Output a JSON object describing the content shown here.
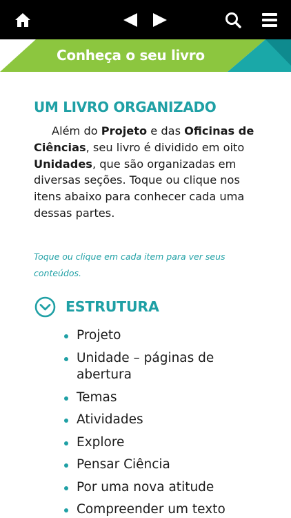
{
  "header": {
    "icons": [
      "home-icon",
      "previous-arrow-icon",
      "next-arrow-icon",
      "search-icon",
      "menu-icon"
    ]
  },
  "banner": {
    "title": "Conheça o seu livro",
    "colors": {
      "green": "#8cc63f",
      "teal": "#1aa8a8",
      "dark_teal": "#0e8a8e"
    }
  },
  "content": {
    "title": "UM LIVRO ORGANIZADO",
    "intro": {
      "part1": "Além do ",
      "bold1": "Projeto",
      "part2": " e das ",
      "bold2": "Oficinas de Ciências",
      "part3": ", seu livro é dividido em oito ",
      "bold3": "Unidades",
      "part4": ", que são organizadas em diversas seções. Toque ou clique nos itens abaixo para conhecer cada uma dessas partes."
    },
    "hint": "Toque ou clique em cada item para ver seus conteúdos."
  },
  "section": {
    "title": "ESTRUTURA",
    "icon": "chevron-down-circle-icon",
    "items": [
      "Projeto",
      "Unidade – páginas de abertura",
      "Temas",
      "Atividades",
      "Explore",
      "Pensar Ciência",
      "Por uma nova atitude",
      "Compreender um texto"
    ]
  },
  "colors": {
    "accent": "#1fa0a5",
    "topbar": "#000000",
    "text": "#1a1a1a"
  }
}
